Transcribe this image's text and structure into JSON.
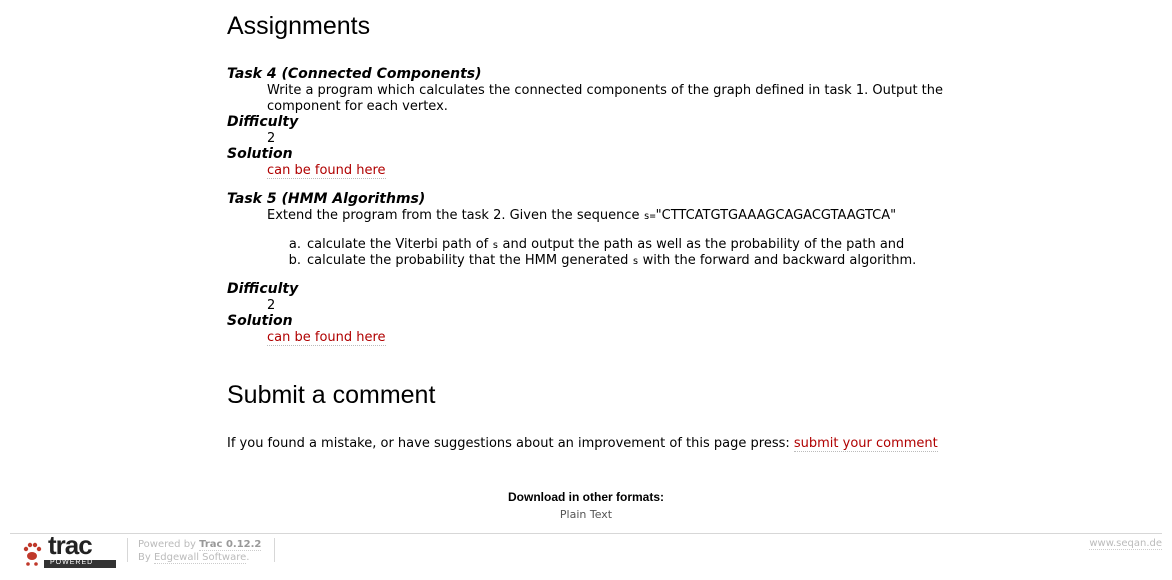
{
  "assignments": {
    "heading": "Assignments",
    "tasks": [
      {
        "title": "Task 4 (Connected Components)",
        "description": "Write a program which calculates the connected components of the graph defined in task 1. Output the component for each vertex.",
        "difficulty_label": "Difficulty",
        "difficulty_value": "2",
        "solution_label": "Solution",
        "solution_link": "can be found here"
      },
      {
        "title": "Task 5 (HMM Algorithms)",
        "description_prefix": "Extend the program from the task 2. Given the sequence ",
        "description_code": "s=",
        "description_suffix": "\"CTTCATGTGAAAGCAGACGTAAGTCA\"",
        "items": [
          {
            "marker": "a.",
            "pre": "calculate the Viterbi path of ",
            "code": "s",
            "post": " and output the path as well as the probability of the path and"
          },
          {
            "marker": "b.",
            "pre": "calculate the probability that the HMM generated ",
            "code": "s",
            "post": " with the forward and backward algorithm."
          }
        ],
        "difficulty_label": "Difficulty",
        "difficulty_value": "2",
        "solution_label": "Solution",
        "solution_link": "can be found here"
      }
    ]
  },
  "comment": {
    "heading": "Submit a comment",
    "text": "If you found a mistake, or have suggestions about an improvement of this page press: ",
    "link": "submit your comment"
  },
  "alt_formats": {
    "heading": "Download in other formats:",
    "link": "Plain Text"
  },
  "footer": {
    "logo_text": "trac",
    "logo_sub": "POWERED",
    "powered_prefix": "Powered by ",
    "powered_product": "Trac 0.12.2",
    "by_prefix": "By ",
    "by_link": "Edgewall Software",
    "by_suffix": ".",
    "site_link": "www.seqan.de"
  },
  "colors": {
    "link": "#b00000",
    "footer_text": "#bbbbbb",
    "logo_red": "#c0392b"
  }
}
